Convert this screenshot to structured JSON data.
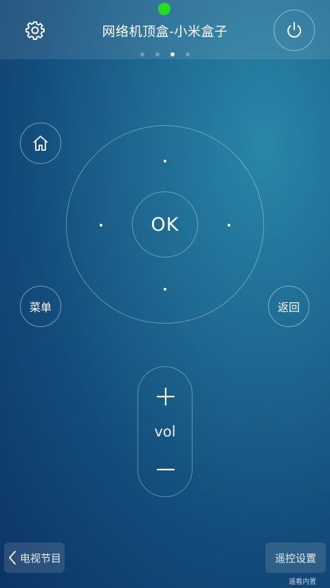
{
  "header": {
    "title": "网络机顶盒-小米盒子",
    "settings_icon": "gear-icon",
    "power_icon": "power-icon",
    "pages": {
      "count": 4,
      "active": 3
    }
  },
  "status": {
    "connected_color": "#22dd22"
  },
  "remote": {
    "home_icon": "home-icon",
    "ok_label": "OK",
    "menu_label": "菜单",
    "back_label": "返回"
  },
  "volume": {
    "label": "vol",
    "plus_icon": "plus-icon",
    "minus_icon": "minus-icon"
  },
  "footer": {
    "tv_guide_label": "电视节目",
    "remote_settings_label": "遥控设置",
    "brand_note": "遥看内置"
  },
  "colors": {
    "background_light": "#2a86a8",
    "background_dark": "#0c3465"
  }
}
